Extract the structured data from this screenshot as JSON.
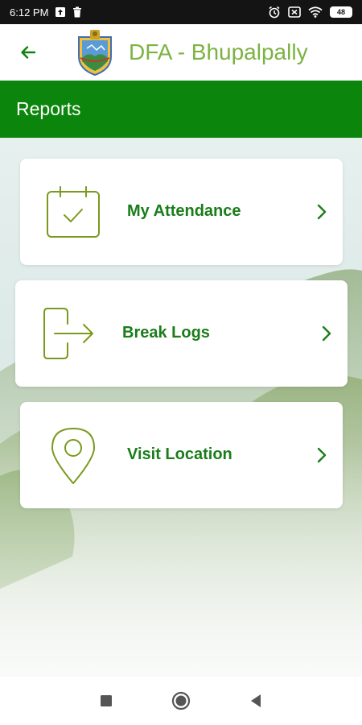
{
  "status_bar": {
    "time": "6:12 PM",
    "battery": "48",
    "left_icons": [
      "upload-notification-icon",
      "delete-notification-icon"
    ],
    "right_icons": [
      "alarm-icon",
      "sim-icon",
      "wifi-icon",
      "battery-icon"
    ]
  },
  "app_bar": {
    "back_icon": "arrow-back-icon",
    "logo": "emblem-logo",
    "title": "DFA - Bhupalpally"
  },
  "section": {
    "title": "Reports"
  },
  "cards": [
    {
      "label": "My Attendance",
      "icon": "calendar-check-icon"
    },
    {
      "label": "Break Logs",
      "icon": "exit-door-icon"
    },
    {
      "label": "Visit Location",
      "icon": "location-pin-icon"
    }
  ],
  "nav_bar": {
    "items": [
      "square-recents-icon",
      "circle-home-icon",
      "triangle-back-icon"
    ]
  },
  "colors": {
    "primary_green": "#0c850c",
    "title_green": "#7cb342",
    "label_green": "#1a7d1a",
    "icon_green": "#7a9a1e",
    "status_bar": "#141414"
  }
}
